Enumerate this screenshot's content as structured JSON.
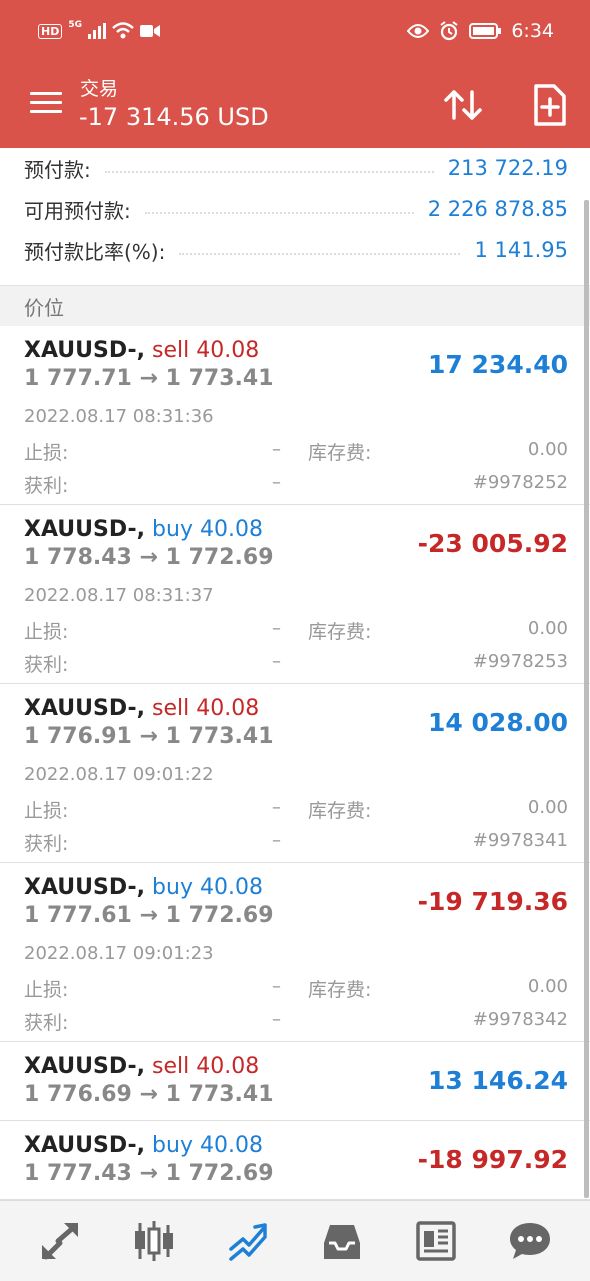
{
  "status_bar": {
    "hd": "HD",
    "signal": "5G",
    "time": "6:34"
  },
  "header": {
    "subtitle": "交易",
    "title": "-17 314.56 USD"
  },
  "summary": [
    {
      "label": "预付款:",
      "value": "213 722.19"
    },
    {
      "label": "可用预付款:",
      "value": "2 226 878.85"
    },
    {
      "label": "预付款比率(%):",
      "value": "1 141.95"
    }
  ],
  "section_label": "价位",
  "positions": [
    {
      "symbol": "XAUUSD-,",
      "side": "sell",
      "volume": "40.08",
      "open_price": "1 777.71",
      "arrow": "→",
      "current_price": "1 773.41",
      "profit": "17 234.40",
      "time": "2022.08.17 08:31:36",
      "sl_label": "止损:",
      "sl_value": "–",
      "swap_label": "库存费:",
      "swap_value": "0.00",
      "tp_label": "获利:",
      "tp_value": "–",
      "ticket": "#9978252"
    },
    {
      "symbol": "XAUUSD-,",
      "side": "buy",
      "volume": "40.08",
      "open_price": "1 778.43",
      "arrow": "→",
      "current_price": "1 772.69",
      "profit": "-23 005.92",
      "time": "2022.08.17 08:31:37",
      "sl_label": "止损:",
      "sl_value": "–",
      "swap_label": "库存费:",
      "swap_value": "0.00",
      "tp_label": "获利:",
      "tp_value": "–",
      "ticket": "#9978253"
    },
    {
      "symbol": "XAUUSD-,",
      "side": "sell",
      "volume": "40.08",
      "open_price": "1 776.91",
      "arrow": "→",
      "current_price": "1 773.41",
      "profit": "14 028.00",
      "time": "2022.08.17 09:01:22",
      "sl_label": "止损:",
      "sl_value": "–",
      "swap_label": "库存费:",
      "swap_value": "0.00",
      "tp_label": "获利:",
      "tp_value": "–",
      "ticket": "#9978341"
    },
    {
      "symbol": "XAUUSD-,",
      "side": "buy",
      "volume": "40.08",
      "open_price": "1 777.61",
      "arrow": "→",
      "current_price": "1 772.69",
      "profit": "-19 719.36",
      "time": "2022.08.17 09:01:23",
      "sl_label": "止损:",
      "sl_value": "–",
      "swap_label": "库存费:",
      "swap_value": "0.00",
      "tp_label": "获利:",
      "tp_value": "–",
      "ticket": "#9978342"
    },
    {
      "symbol": "XAUUSD-,",
      "side": "sell",
      "volume": "40.08",
      "open_price": "1 776.69",
      "arrow": "→",
      "current_price": "1 773.41",
      "profit": "13 146.24"
    },
    {
      "symbol": "XAUUSD-,",
      "side": "buy",
      "volume": "40.08",
      "open_price": "1 777.43",
      "arrow": "→",
      "current_price": "1 772.69",
      "profit": "-18 997.92"
    }
  ],
  "nav": [
    {
      "name": "quotes",
      "icon": "quotes-arrows-icon"
    },
    {
      "name": "chart",
      "icon": "candlestick-chart-icon"
    },
    {
      "name": "trade",
      "icon": "trade-trend-icon",
      "active": true
    },
    {
      "name": "history",
      "icon": "history-inbox-icon"
    },
    {
      "name": "news",
      "icon": "news-icon"
    },
    {
      "name": "messages",
      "icon": "chat-bubble-icon"
    }
  ],
  "colors": {
    "header_bg": "#d9534a",
    "accent_blue": "#1e7fd6",
    "loss_red": "#c62828"
  }
}
